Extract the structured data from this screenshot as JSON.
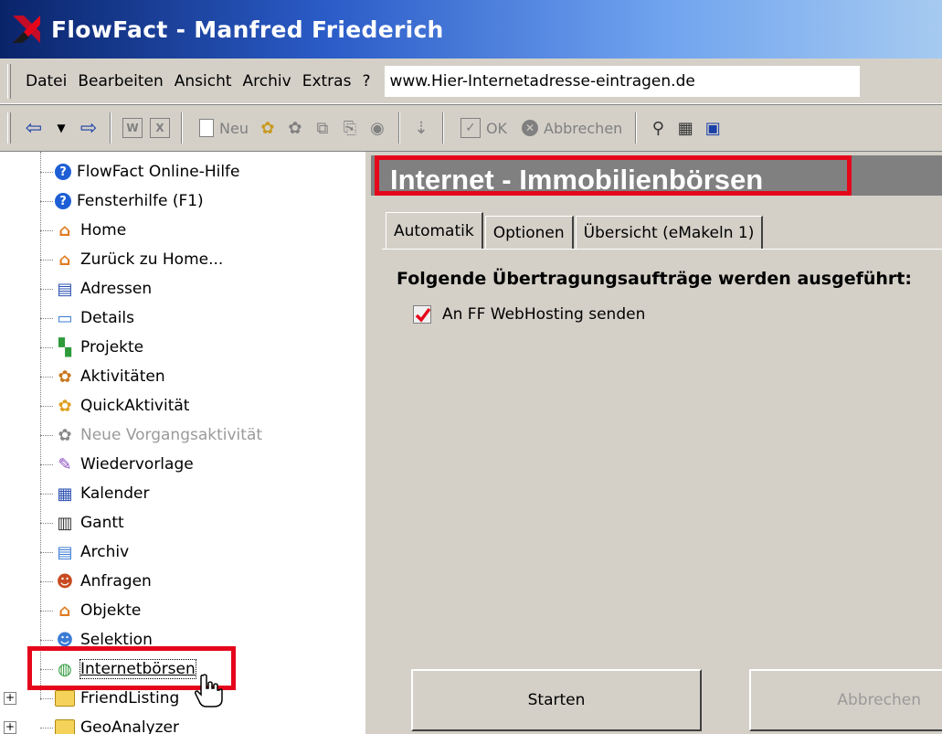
{
  "window": {
    "title": "FlowFact - Manfred Friederich"
  },
  "menu": {
    "items": [
      "Datei",
      "Bearbeiten",
      "Ansicht",
      "Archiv",
      "Extras",
      "?"
    ],
    "url_value": "www.Hier-Internetadresse-eintragen.de"
  },
  "toolbar": {
    "new_label": "Neu",
    "ok_label": "OK",
    "cancel_label": "Abbrechen"
  },
  "tree": {
    "items": [
      {
        "label": "FlowFact Online-Hilfe",
        "icon": "help-icon"
      },
      {
        "label": "Fensterhilfe (F1)",
        "icon": "help-icon"
      },
      {
        "label": "Home",
        "icon": "home-icon"
      },
      {
        "label": "Zurück zu Home...",
        "icon": "home-back-icon"
      },
      {
        "label": "Adressen",
        "icon": "address-card-icon"
      },
      {
        "label": "Details",
        "icon": "details-icon"
      },
      {
        "label": "Projekte",
        "icon": "projects-icon"
      },
      {
        "label": "Aktivitäten",
        "icon": "activities-icon"
      },
      {
        "label": "QuickAktivität",
        "icon": "quick-activity-icon"
      },
      {
        "label": "Neue Vorgangsaktivität",
        "icon": "process-activity-icon"
      },
      {
        "label": "Wiedervorlage",
        "icon": "resubmission-icon"
      },
      {
        "label": "Kalender",
        "icon": "calendar-icon"
      },
      {
        "label": "Gantt",
        "icon": "gantt-icon"
      },
      {
        "label": "Archiv",
        "icon": "archive-icon"
      },
      {
        "label": "Anfragen",
        "icon": "inquiries-icon"
      },
      {
        "label": "Objekte",
        "icon": "objects-icon"
      },
      {
        "label": "Selektion",
        "icon": "selection-icon"
      },
      {
        "label": "Internetbörsen",
        "icon": "internet-exchange-icon"
      },
      {
        "label": "FriendListing",
        "icon": "folder-icon"
      },
      {
        "label": "GeoAnalyzer",
        "icon": "folder-icon"
      }
    ]
  },
  "main": {
    "title": "Internet - Immobilienbörsen",
    "tabs": [
      "Automatik",
      "Optionen",
      "Übersicht (eMakeln 1)"
    ],
    "section_heading": "Folgende Übertragungsaufträge werden ausgeführt:",
    "task_label": "An FF WebHosting senden",
    "task_checked": true,
    "start_label": "Starten",
    "abort_label": "Abbrechen"
  },
  "colors": {
    "highlight": "#e5061b",
    "title_gradient_start": "#0a246a",
    "title_gradient_end": "#a6caf0"
  }
}
